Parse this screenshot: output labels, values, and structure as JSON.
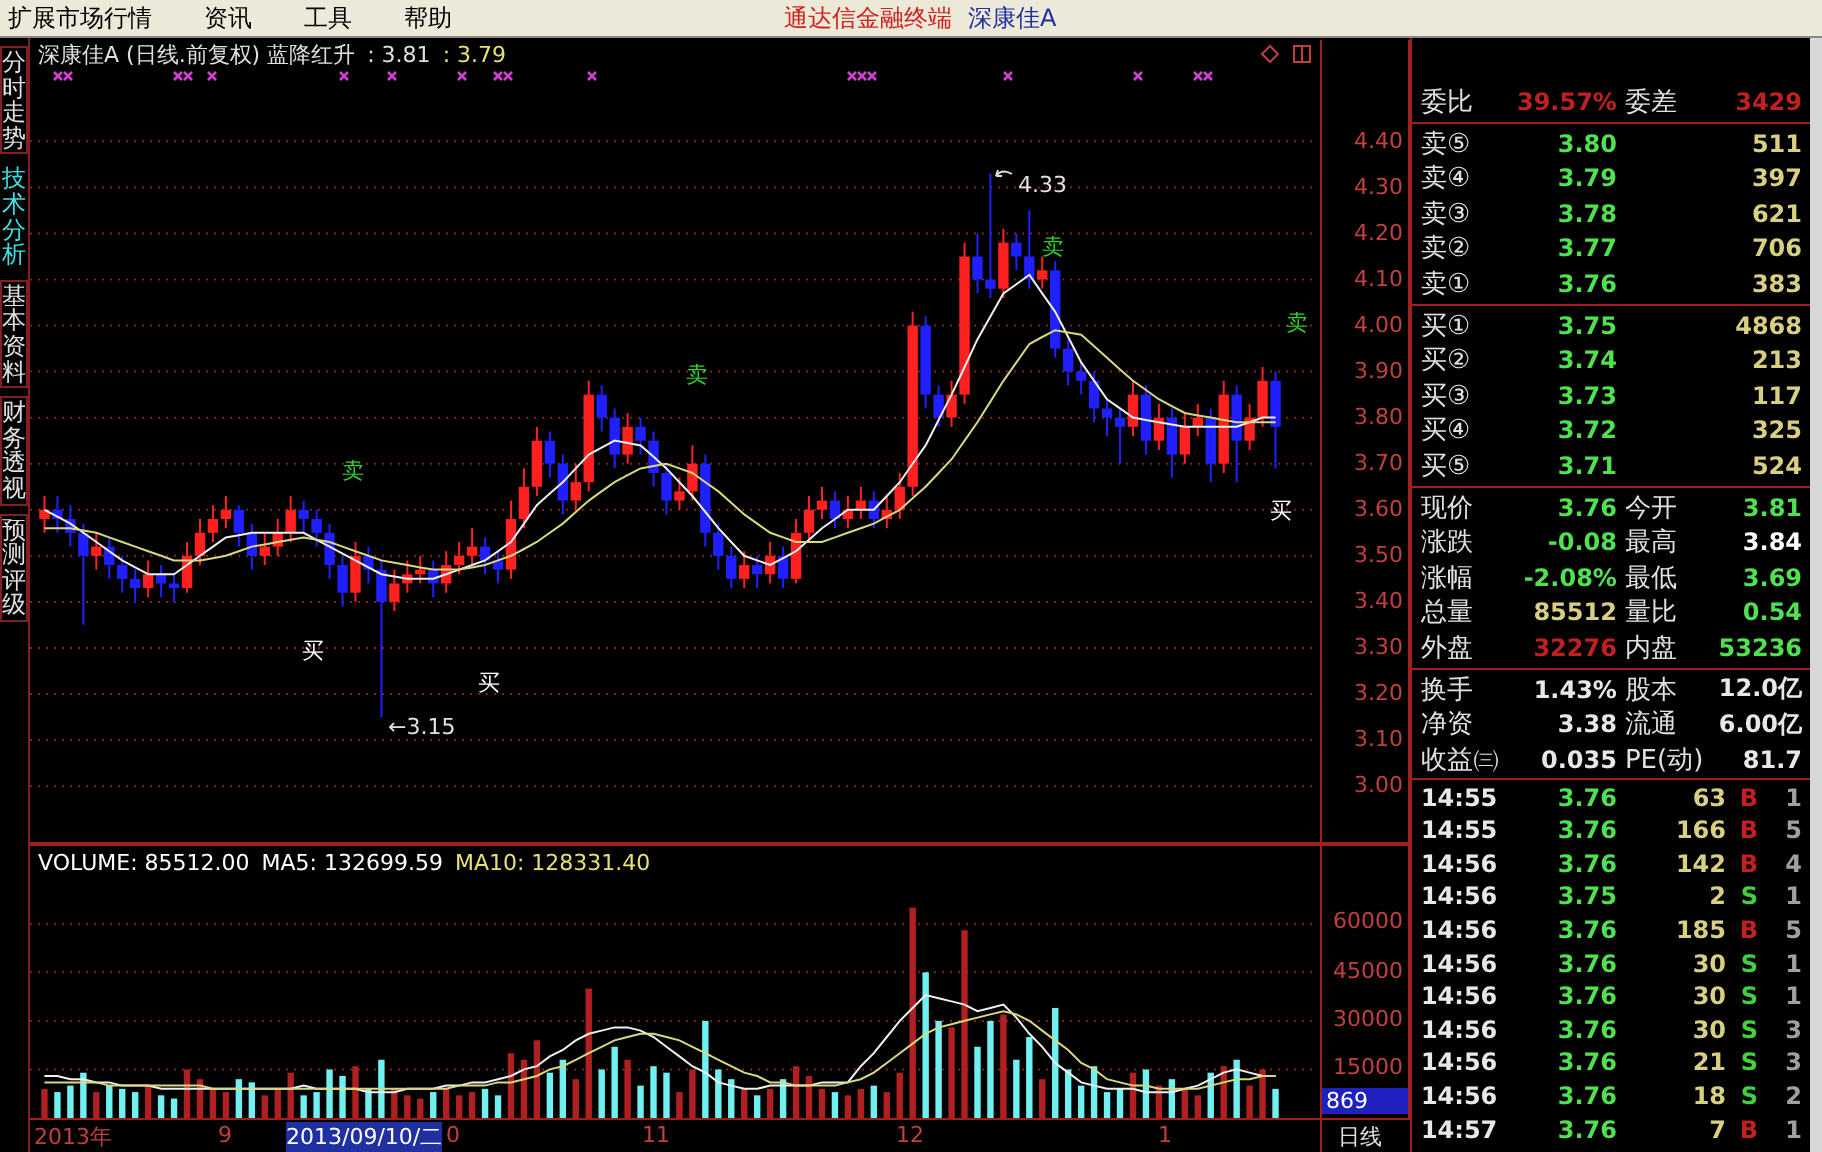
{
  "menu": [
    "扩展市场行情",
    "资讯",
    "工具",
    "帮助"
  ],
  "title": {
    "app": "通达信金融终端",
    "stock": "深康佳A"
  },
  "side_tabs": [
    {
      "label": "分时走势",
      "selected": false
    },
    {
      "label": "技术分析",
      "selected": true
    },
    {
      "label": "基本资料",
      "selected": false
    },
    {
      "label": "财务透视",
      "selected": false
    },
    {
      "label": "预测评级",
      "selected": false
    }
  ],
  "price_chart": {
    "header": {
      "name": "深康佳A (日线.前复权) 蓝降红升",
      "value_1": ": 3.81",
      "value_2": ": 3.79"
    },
    "chart_data": {
      "type": "candlestick",
      "ylim": [
        2.87,
        4.62
      ],
      "grid": true,
      "yticks": [
        {
          "value": 4.4,
          "label": "4.40"
        },
        {
          "value": 4.3,
          "label": "4.30"
        },
        {
          "value": 4.2,
          "label": "4.20"
        },
        {
          "value": 4.1,
          "label": "4.10"
        },
        {
          "value": 4.0,
          "label": "4.00"
        },
        {
          "value": 3.9,
          "label": "3.90"
        },
        {
          "value": 3.8,
          "label": "3.80"
        },
        {
          "value": 3.7,
          "label": "3.70"
        },
        {
          "value": 3.6,
          "label": "3.60"
        },
        {
          "value": 3.5,
          "label": "3.50"
        },
        {
          "value": 3.4,
          "label": "3.40"
        },
        {
          "value": 3.3,
          "label": "3.30"
        },
        {
          "value": 3.2,
          "label": "3.20"
        },
        {
          "value": 3.1,
          "label": "3.10"
        },
        {
          "value": 3.0,
          "label": "3.00"
        }
      ],
      "ohlc": [
        [
          3.58,
          3.63,
          3.55,
          3.6
        ],
        [
          3.6,
          3.63,
          3.55,
          3.58
        ],
        [
          3.58,
          3.61,
          3.52,
          3.55
        ],
        [
          3.55,
          3.57,
          3.35,
          3.5
        ],
        [
          3.5,
          3.55,
          3.47,
          3.52
        ],
        [
          3.52,
          3.54,
          3.45,
          3.48
        ],
        [
          3.48,
          3.5,
          3.42,
          3.45
        ],
        [
          3.45,
          3.47,
          3.4,
          3.43
        ],
        [
          3.43,
          3.49,
          3.41,
          3.46
        ],
        [
          3.46,
          3.48,
          3.41,
          3.44
        ],
        [
          3.44,
          3.46,
          3.4,
          3.43
        ],
        [
          3.43,
          3.53,
          3.42,
          3.5
        ],
        [
          3.5,
          3.58,
          3.48,
          3.55
        ],
        [
          3.55,
          3.61,
          3.53,
          3.58
        ],
        [
          3.58,
          3.63,
          3.56,
          3.6
        ],
        [
          3.6,
          3.61,
          3.52,
          3.55
        ],
        [
          3.55,
          3.57,
          3.47,
          3.5
        ],
        [
          3.5,
          3.55,
          3.48,
          3.52
        ],
        [
          3.52,
          3.58,
          3.5,
          3.55
        ],
        [
          3.55,
          3.63,
          3.53,
          3.6
        ],
        [
          3.6,
          3.62,
          3.55,
          3.58
        ],
        [
          3.58,
          3.6,
          3.52,
          3.55
        ],
        [
          3.55,
          3.57,
          3.45,
          3.48
        ],
        [
          3.48,
          3.5,
          3.39,
          3.42
        ],
        [
          3.42,
          3.53,
          3.4,
          3.5
        ],
        [
          3.5,
          3.52,
          3.44,
          3.47
        ],
        [
          3.47,
          3.49,
          3.15,
          3.4
        ],
        [
          3.4,
          3.47,
          3.38,
          3.44
        ],
        [
          3.44,
          3.49,
          3.42,
          3.46
        ],
        [
          3.46,
          3.5,
          3.44,
          3.47
        ],
        [
          3.47,
          3.49,
          3.41,
          3.44
        ],
        [
          3.44,
          3.51,
          3.42,
          3.48
        ],
        [
          3.48,
          3.53,
          3.46,
          3.5
        ],
        [
          3.5,
          3.56,
          3.48,
          3.52
        ],
        [
          3.52,
          3.54,
          3.46,
          3.49
        ],
        [
          3.49,
          3.51,
          3.44,
          3.47
        ],
        [
          3.47,
          3.62,
          3.45,
          3.58
        ],
        [
          3.58,
          3.69,
          3.56,
          3.65
        ],
        [
          3.65,
          3.78,
          3.63,
          3.75
        ],
        [
          3.75,
          3.77,
          3.67,
          3.7
        ],
        [
          3.7,
          3.72,
          3.59,
          3.62
        ],
        [
          3.62,
          3.7,
          3.6,
          3.66
        ],
        [
          3.66,
          3.88,
          3.64,
          3.85
        ],
        [
          3.85,
          3.87,
          3.77,
          3.8
        ],
        [
          3.8,
          3.82,
          3.69,
          3.72
        ],
        [
          3.72,
          3.81,
          3.7,
          3.78
        ],
        [
          3.78,
          3.8,
          3.72,
          3.75
        ],
        [
          3.75,
          3.77,
          3.65,
          3.68
        ],
        [
          3.68,
          3.7,
          3.59,
          3.62
        ],
        [
          3.62,
          3.67,
          3.6,
          3.64
        ],
        [
          3.64,
          3.74,
          3.62,
          3.7
        ],
        [
          3.7,
          3.72,
          3.52,
          3.55
        ],
        [
          3.55,
          3.57,
          3.47,
          3.5
        ],
        [
          3.5,
          3.52,
          3.43,
          3.45
        ],
        [
          3.45,
          3.51,
          3.43,
          3.48
        ],
        [
          3.48,
          3.5,
          3.43,
          3.46
        ],
        [
          3.46,
          3.53,
          3.44,
          3.5
        ],
        [
          3.5,
          3.52,
          3.43,
          3.45
        ],
        [
          3.45,
          3.58,
          3.44,
          3.55
        ],
        [
          3.55,
          3.63,
          3.53,
          3.6
        ],
        [
          3.6,
          3.65,
          3.58,
          3.62
        ],
        [
          3.62,
          3.64,
          3.56,
          3.58
        ],
        [
          3.58,
          3.63,
          3.56,
          3.6
        ],
        [
          3.6,
          3.65,
          3.58,
          3.62
        ],
        [
          3.62,
          3.64,
          3.56,
          3.58
        ],
        [
          3.58,
          3.63,
          3.56,
          3.6
        ],
        [
          3.6,
          3.68,
          3.58,
          3.65
        ],
        [
          3.65,
          4.03,
          3.63,
          4.0
        ],
        [
          4.0,
          4.02,
          3.82,
          3.85
        ],
        [
          3.85,
          3.87,
          3.78,
          3.8
        ],
        [
          3.8,
          3.88,
          3.78,
          3.85
        ],
        [
          3.85,
          4.18,
          3.83,
          4.15
        ],
        [
          4.15,
          4.2,
          4.07,
          4.1
        ],
        [
          4.1,
          4.33,
          4.06,
          4.08
        ],
        [
          4.08,
          4.21,
          4.06,
          4.18
        ],
        [
          4.18,
          4.2,
          4.12,
          4.15
        ],
        [
          4.15,
          4.25,
          4.08,
          4.1
        ],
        [
          4.1,
          4.15,
          4.08,
          4.12
        ],
        [
          4.12,
          4.14,
          3.93,
          3.95
        ],
        [
          3.95,
          3.97,
          3.87,
          3.9
        ],
        [
          3.9,
          3.92,
          3.85,
          3.88
        ],
        [
          3.88,
          3.9,
          3.79,
          3.82
        ],
        [
          3.82,
          3.84,
          3.76,
          3.8
        ],
        [
          3.8,
          3.82,
          3.7,
          3.78
        ],
        [
          3.78,
          3.88,
          3.76,
          3.85
        ],
        [
          3.85,
          3.87,
          3.72,
          3.75
        ],
        [
          3.75,
          3.83,
          3.73,
          3.8
        ],
        [
          3.8,
          3.82,
          3.67,
          3.72
        ],
        [
          3.72,
          3.81,
          3.7,
          3.78
        ],
        [
          3.78,
          3.83,
          3.76,
          3.8
        ],
        [
          3.8,
          3.82,
          3.66,
          3.7
        ],
        [
          3.7,
          3.88,
          3.68,
          3.85
        ],
        [
          3.85,
          3.87,
          3.66,
          3.75
        ],
        [
          3.75,
          3.83,
          3.73,
          3.8
        ],
        [
          3.8,
          3.91,
          3.78,
          3.88
        ],
        [
          3.88,
          3.9,
          3.69,
          3.78
        ]
      ],
      "series": [
        {
          "type": "line",
          "color": "#f0f0f0",
          "values": [
            3.6,
            3.585,
            3.57,
            3.55,
            3.53,
            3.51,
            3.49,
            3.475,
            3.46,
            3.46,
            3.46,
            3.48,
            3.5,
            3.52,
            3.54,
            3.545,
            3.55,
            3.55,
            3.55,
            3.55,
            3.55,
            3.535,
            3.52,
            3.505,
            3.49,
            3.475,
            3.46,
            3.455,
            3.45,
            3.45,
            3.45,
            3.46,
            3.47,
            3.48,
            3.49,
            3.51,
            3.53,
            3.57,
            3.61,
            3.635,
            3.66,
            3.69,
            3.72,
            3.735,
            3.75,
            3.745,
            3.74,
            3.715,
            3.69,
            3.66,
            3.63,
            3.595,
            3.56,
            3.53,
            3.5,
            3.49,
            3.48,
            3.495,
            3.51,
            3.535,
            3.56,
            3.58,
            3.6,
            3.6,
            3.6,
            3.63,
            3.66,
            3.7,
            3.74,
            3.795,
            3.85,
            3.91,
            3.97,
            4.02,
            4.07,
            4.09,
            4.11,
            4.07,
            4.03,
            3.975,
            3.92,
            3.88,
            3.84,
            3.82,
            3.8,
            3.795,
            3.79,
            3.785,
            3.78,
            3.78,
            3.78,
            3.78,
            3.78,
            3.79,
            3.8,
            3.8
          ]
        },
        {
          "type": "line",
          "color": "#d8d880",
          "values": [
            3.56,
            3.56,
            3.56,
            3.555,
            3.55,
            3.54,
            3.53,
            3.52,
            3.51,
            3.5,
            3.49,
            3.49,
            3.49,
            3.495,
            3.5,
            3.51,
            3.52,
            3.525,
            3.53,
            3.535,
            3.54,
            3.535,
            3.53,
            3.52,
            3.51,
            3.5,
            3.49,
            3.485,
            3.48,
            3.475,
            3.47,
            3.47,
            3.47,
            3.475,
            3.48,
            3.49,
            3.5,
            3.515,
            3.53,
            3.55,
            3.57,
            3.595,
            3.62,
            3.64,
            3.66,
            3.675,
            3.69,
            3.695,
            3.7,
            3.69,
            3.68,
            3.66,
            3.64,
            3.615,
            3.59,
            3.57,
            3.55,
            3.54,
            3.53,
            3.53,
            3.53,
            3.54,
            3.55,
            3.56,
            3.57,
            3.585,
            3.6,
            3.625,
            3.65,
            3.68,
            3.71,
            3.75,
            3.79,
            3.835,
            3.88,
            3.92,
            3.96,
            3.975,
            3.99,
            3.985,
            3.98,
            3.955,
            3.93,
            3.905,
            3.88,
            3.86,
            3.84,
            3.825,
            3.81,
            3.805,
            3.8,
            3.795,
            3.79,
            3.79,
            3.79,
            3.79
          ]
        }
      ]
    },
    "signals": [
      {
        "kind": "sell",
        "label": "卖"
      },
      {
        "kind": "sell",
        "label": "卖"
      },
      {
        "kind": "sell",
        "label": "卖"
      },
      {
        "kind": "sell",
        "label": "卖"
      },
      {
        "kind": "buy",
        "label": "买"
      },
      {
        "kind": "buy",
        "label": "买"
      },
      {
        "kind": "buy",
        "label": "买"
      }
    ],
    "high_label": "4.33",
    "low_label": "←3.15"
  },
  "volume_chart": {
    "header": [
      {
        "kind": "total",
        "label": "VOLUME: 85512.00"
      },
      {
        "kind": "ma5",
        "label": "MA5: 132699.59"
      },
      {
        "kind": "ma10",
        "label": "MA10: 128331.40"
      }
    ],
    "chart_data": {
      "type": "bar",
      "ylim": [
        0,
        83400
      ],
      "grid": true,
      "stacked": true,
      "yticks": [
        {
          "value": 60000,
          "label": "60000"
        },
        {
          "value": 45000,
          "label": "45000"
        },
        {
          "value": 30000,
          "label": "30000"
        },
        {
          "value": 15000,
          "label": "15000"
        }
      ],
      "series": [
        {
          "type": "bar",
          "color": "#b02020",
          "values": [
            9000,
            null,
            null,
            null,
            8000,
            null,
            null,
            null,
            10000,
            null,
            null,
            15000,
            12000,
            9000,
            8000,
            null,
            null,
            7000,
            9000,
            14000,
            null,
            null,
            null,
            null,
            16000,
            null,
            null,
            9000,
            7000,
            6000,
            null,
            9000,
            7000,
            8000,
            null,
            null,
            20000,
            18000,
            24000,
            null,
            null,
            12000,
            40000,
            null,
            null,
            18000,
            null,
            null,
            null,
            8000,
            15000,
            null,
            null,
            null,
            9000,
            null,
            9000,
            null,
            16000,
            13000,
            9000,
            null,
            7000,
            9000,
            null,
            8000,
            14000,
            65000,
            null,
            null,
            28000,
            58000,
            null,
            null,
            32000,
            null,
            null,
            12000,
            null,
            null,
            null,
            null,
            null,
            null,
            14000,
            null,
            10000,
            null,
            9000,
            7000,
            null,
            16000,
            null,
            10000,
            15000,
            null
          ]
        },
        {
          "type": "bar",
          "color": "#70f0f0",
          "values": [
            null,
            8000,
            10000,
            14000,
            null,
            10000,
            9000,
            8000,
            null,
            7000,
            6000,
            null,
            null,
            null,
            null,
            12000,
            11000,
            null,
            null,
            null,
            7000,
            8000,
            15000,
            13000,
            null,
            9000,
            18000,
            null,
            null,
            null,
            8000,
            null,
            null,
            null,
            9000,
            7000,
            null,
            null,
            null,
            14000,
            18000,
            null,
            null,
            15000,
            22000,
            null,
            10000,
            16000,
            14000,
            null,
            null,
            30000,
            15000,
            12000,
            null,
            7000,
            null,
            12000,
            null,
            null,
            null,
            8000,
            null,
            null,
            10000,
            null,
            null,
            null,
            45000,
            30000,
            null,
            null,
            22000,
            30000,
            null,
            18000,
            25000,
            null,
            34000,
            15000,
            10000,
            16000,
            8000,
            9000,
            null,
            15000,
            null,
            12000,
            null,
            null,
            14000,
            null,
            18000,
            null,
            null,
            9000
          ]
        },
        {
          "type": "line",
          "color": "#f0f0f0",
          "values": [
            13000,
            13000,
            12000,
            12000,
            11000,
            11000,
            10000,
            10000,
            10000,
            9000,
            9000,
            9000,
            9000,
            9000,
            9000,
            9000,
            9000,
            9000,
            9000,
            9000,
            10000,
            9000,
            9000,
            9000,
            9000,
            8000,
            8000,
            8000,
            9000,
            9000,
            9000,
            10000,
            10000,
            11000,
            11000,
            12000,
            13000,
            15000,
            16000,
            19000,
            21000,
            24000,
            26000,
            27000,
            28000,
            28000,
            27000,
            25000,
            22000,
            19000,
            16000,
            14000,
            11000,
            10000,
            9000,
            9000,
            10000,
            10000,
            10000,
            10000,
            11000,
            11000,
            11000,
            16000,
            20000,
            25000,
            30000,
            34000,
            38000,
            37000,
            36000,
            35000,
            33000,
            34000,
            35000,
            31000,
            26000,
            22000,
            17000,
            14000,
            11000,
            10000,
            9000,
            9000,
            9000,
            8000,
            8000,
            8000,
            9000,
            10000,
            12000,
            14000,
            15000,
            14000,
            13000,
            13000
          ]
        },
        {
          "type": "line",
          "color": "#d8d880",
          "values": [
            11000,
            11000,
            11000,
            11000,
            11000,
            10000,
            10000,
            10000,
            10000,
            10000,
            10000,
            10000,
            10000,
            9000,
            9000,
            9000,
            9000,
            9000,
            9000,
            9000,
            9000,
            9000,
            9000,
            9000,
            9000,
            9000,
            9000,
            9000,
            9000,
            9000,
            9000,
            9000,
            10000,
            10000,
            10000,
            11000,
            11000,
            12000,
            13000,
            15000,
            16000,
            18000,
            20000,
            22000,
            24000,
            25000,
            26000,
            26000,
            25000,
            24000,
            22000,
            20000,
            18000,
            16000,
            14000,
            13000,
            11000,
            11000,
            10000,
            10000,
            10000,
            10000,
            11000,
            12000,
            14000,
            17000,
            20000,
            23000,
            26000,
            28000,
            29000,
            30000,
            31000,
            32000,
            33000,
            32000,
            30000,
            27000,
            24000,
            21000,
            17000,
            15000,
            12000,
            11000,
            10000,
            10000,
            9000,
            9000,
            9000,
            9000,
            10000,
            11000,
            12000,
            12000,
            13000,
            13000
          ]
        }
      ]
    },
    "cursor_value": "869"
  },
  "date_axis": {
    "labels": [
      "2013年",
      "9",
      "0",
      "11",
      "12",
      "1"
    ],
    "cursor_date": "2013/09/10/二",
    "period": "日线"
  },
  "quote": {
    "ratio": {
      "label": "委比",
      "value": "39.57%",
      "label_2": "委差",
      "value_2": "3429"
    },
    "asks": [
      {
        "label": "卖⑤",
        "price": "3.80",
        "volume": "511"
      },
      {
        "label": "卖④",
        "price": "3.79",
        "volume": "397"
      },
      {
        "label": "卖③",
        "price": "3.78",
        "volume": "621"
      },
      {
        "label": "卖②",
        "price": "3.77",
        "volume": "706"
      },
      {
        "label": "卖①",
        "price": "3.76",
        "volume": "383"
      }
    ],
    "bids": [
      {
        "label": "买①",
        "price": "3.75",
        "volume": "4868"
      },
      {
        "label": "买②",
        "price": "3.74",
        "volume": "213"
      },
      {
        "label": "买③",
        "price": "3.73",
        "volume": "117"
      },
      {
        "label": "买④",
        "price": "3.72",
        "volume": "325"
      },
      {
        "label": "买⑤",
        "price": "3.71",
        "volume": "524"
      }
    ],
    "stats": [
      {
        "cells": [
          {
            "label": "现价",
            "value": "3.76",
            "color": "#50e050"
          },
          {
            "label": "今开",
            "value": "3.81",
            "color": "#50e050"
          }
        ]
      },
      {
        "cells": [
          {
            "label": "涨跌",
            "value": "-0.08",
            "color": "#50e050"
          },
          {
            "label": "最高",
            "value": "3.84",
            "color": "#ffffff"
          }
        ]
      },
      {
        "cells": [
          {
            "label": "涨幅",
            "value": "-2.08%",
            "color": "#50e050"
          },
          {
            "label": "最低",
            "value": "3.69",
            "color": "#50e050"
          }
        ]
      },
      {
        "cells": [
          {
            "label": "总量",
            "value": "85512",
            "color": "#d8d080"
          },
          {
            "label": "量比",
            "value": "0.54",
            "color": "#50e050"
          }
        ]
      },
      {
        "cells": [
          {
            "label": "外盘",
            "value": "32276",
            "color": "#c02020"
          },
          {
            "label": "内盘",
            "value": "53236",
            "color": "#50e050"
          }
        ]
      }
    ],
    "extra": [
      {
        "label": "换手",
        "value": "1.43%",
        "label_2": "股本",
        "value_2": "12.0亿"
      },
      {
        "label": "净资",
        "value": "3.38",
        "label_2": "流通",
        "value_2": "6.00亿"
      },
      {
        "label": "收益㈢",
        "value": "0.035",
        "label_2": "PE(动)",
        "value_2": "81.7"
      }
    ]
  },
  "ticks": [
    {
      "time": "14:55",
      "price": "3.76",
      "volume": "63",
      "side": "B",
      "buy": true,
      "count": "1"
    },
    {
      "time": "14:55",
      "price": "3.76",
      "volume": "166",
      "side": "B",
      "buy": true,
      "count": "5"
    },
    {
      "time": "14:56",
      "price": "3.76",
      "volume": "142",
      "side": "B",
      "buy": true,
      "count": "4"
    },
    {
      "time": "14:56",
      "price": "3.75",
      "volume": "2",
      "side": "S",
      "buy": false,
      "count": "1"
    },
    {
      "time": "14:56",
      "price": "3.76",
      "volume": "185",
      "side": "B",
      "buy": true,
      "count": "5"
    },
    {
      "time": "14:56",
      "price": "3.76",
      "volume": "30",
      "side": "S",
      "buy": false,
      "count": "1"
    },
    {
      "time": "14:56",
      "price": "3.76",
      "volume": "30",
      "side": "S",
      "buy": false,
      "count": "1"
    },
    {
      "time": "14:56",
      "price": "3.76",
      "volume": "30",
      "side": "S",
      "buy": false,
      "count": "3"
    },
    {
      "time": "14:56",
      "price": "3.76",
      "volume": "21",
      "side": "S",
      "buy": false,
      "count": "3"
    },
    {
      "time": "14:56",
      "price": "3.76",
      "volume": "18",
      "side": "S",
      "buy": false,
      "count": "2"
    },
    {
      "time": "14:57",
      "price": "3.76",
      "volume": "7",
      "side": "B",
      "buy": true,
      "count": "1"
    }
  ]
}
